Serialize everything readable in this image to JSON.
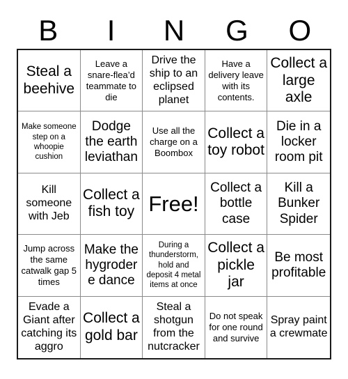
{
  "card": {
    "headers": [
      "B",
      "I",
      "N",
      "G",
      "O"
    ],
    "rows": [
      [
        {
          "text": "Steal a beehive",
          "size": "t-xl"
        },
        {
          "text": "Leave a snare-flea’d teammate to die",
          "size": "t-sm"
        },
        {
          "text": "Drive the ship to an eclipsed planet",
          "size": "t-md"
        },
        {
          "text": "Have a delivery leave with its contents.",
          "size": "t-sm"
        },
        {
          "text": "Collect a large axle",
          "size": "t-xl"
        }
      ],
      [
        {
          "text": "Make someone step on a whoopie cushion",
          "size": "t-xs"
        },
        {
          "text": "Dodge the earth leviathan",
          "size": "t-lg"
        },
        {
          "text": "Use all the charge on a Boombox",
          "size": "t-sm"
        },
        {
          "text": "Collect a toy robot",
          "size": "t-xl"
        },
        {
          "text": "Die in a locker room pit",
          "size": "t-lg"
        }
      ],
      [
        {
          "text": "Kill someone with Jeb",
          "size": "t-md"
        },
        {
          "text": "Collect a fish toy",
          "size": "t-xl"
        },
        {
          "text": "Free!",
          "size": "t-free"
        },
        {
          "text": "Collect a bottle case",
          "size": "t-lg"
        },
        {
          "text": "Kill a Bunker Spider",
          "size": "t-lg"
        }
      ],
      [
        {
          "text": "Jump across the same catwalk gap 5 times",
          "size": "t-sm"
        },
        {
          "text": "Make the hygrodere dance",
          "size": "t-lg"
        },
        {
          "text": "During a thunderstorm, hold and deposit 4 metal items at once",
          "size": "t-xs"
        },
        {
          "text": "Collect a pickle jar",
          "size": "t-xl"
        },
        {
          "text": "Be most profitable",
          "size": "t-lg"
        }
      ],
      [
        {
          "text": "Evade a Giant after catching its aggro",
          "size": "t-md"
        },
        {
          "text": "Collect a gold bar",
          "size": "t-xl"
        },
        {
          "text": "Steal a shotgun from the nutcracker",
          "size": "t-md"
        },
        {
          "text": "Do not speak for one round and survive",
          "size": "t-sm"
        },
        {
          "text": "Spray paint a crewmate",
          "size": "t-md"
        }
      ]
    ]
  },
  "colors": {
    "background": "#ffffff",
    "text": "#000000",
    "outer_border": "#1a1a1a",
    "inner_grid_line": "#8a8a8a"
  }
}
